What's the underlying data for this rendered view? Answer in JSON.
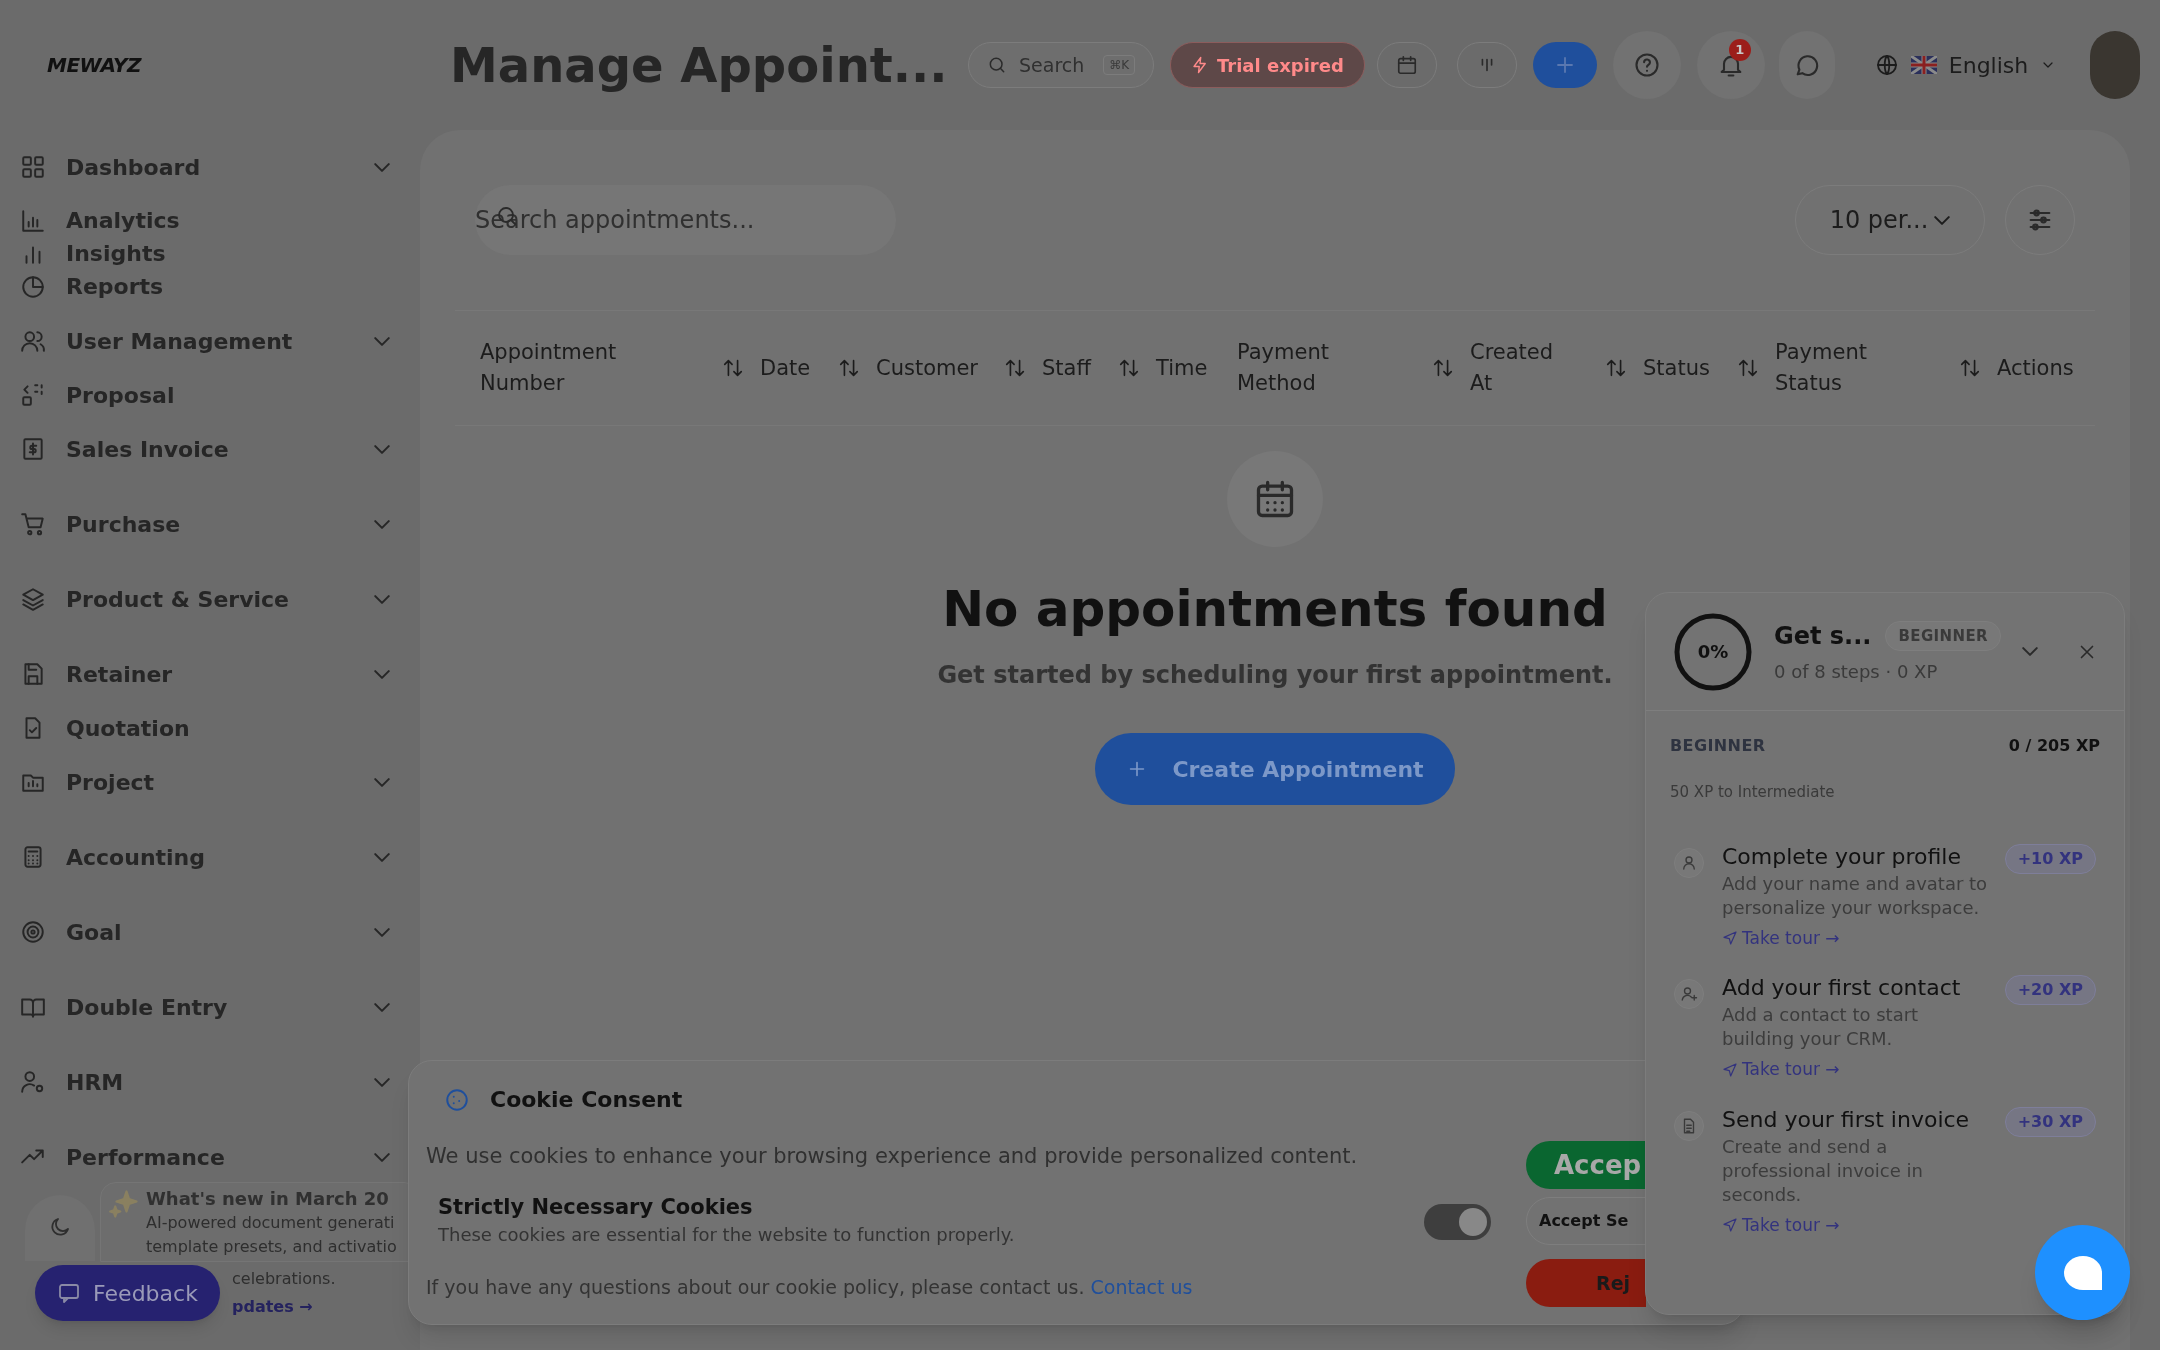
{
  "header": {
    "logo": "MEWAYZ",
    "title": "Manage Appoint...",
    "search": {
      "placeholder": "Search",
      "shortcut": "⌘K"
    },
    "trial_badge": "Trial expired",
    "notification_count": "1",
    "language": "English"
  },
  "sidebar": {
    "items": [
      {
        "kind": "group",
        "label": "Dashboard",
        "children": [
          {
            "label": "Analytics"
          },
          {
            "label": "Insights"
          },
          {
            "label": "Reports"
          }
        ]
      },
      {
        "kind": "group",
        "label": "User Management"
      },
      {
        "kind": "link",
        "label": "Proposal"
      },
      {
        "kind": "group",
        "label": "Sales Invoice"
      },
      {
        "kind": "group",
        "label": "Purchase"
      },
      {
        "kind": "group",
        "label": "Product & Service"
      },
      {
        "kind": "group",
        "label": "Retainer"
      },
      {
        "kind": "link",
        "label": "Quotation"
      },
      {
        "kind": "group",
        "label": "Project"
      },
      {
        "kind": "group",
        "label": "Accounting"
      },
      {
        "kind": "group",
        "label": "Goal"
      },
      {
        "kind": "group",
        "label": "Double Entry"
      },
      {
        "kind": "group",
        "label": "HRM"
      },
      {
        "kind": "group",
        "label": "Performance"
      }
    ],
    "whats_new": {
      "title": "What's new in March 20",
      "lines": [
        "AI-powered document generati",
        "template presets, and activatio"
      ],
      "tail": "celebrations.",
      "link": "pdates →"
    },
    "feedback": "Feedback"
  },
  "toolbar": {
    "search": {
      "placeholder": "Search appointments..."
    },
    "per_page": "10 per..."
  },
  "table": {
    "columns": [
      {
        "label": "Appointment Number",
        "sortable": true
      },
      {
        "label": "Date",
        "sortable": true
      },
      {
        "label": "Customer",
        "sortable": true
      },
      {
        "label": "Staff",
        "sortable": true
      },
      {
        "label": "Time",
        "sortable": false
      },
      {
        "label": "Payment Method",
        "sortable": true
      },
      {
        "label": "Created At",
        "sortable": true
      },
      {
        "label": "Status",
        "sortable": true
      },
      {
        "label": "Payment Status",
        "sortable": true
      },
      {
        "label": "Actions",
        "sortable": false
      }
    ]
  },
  "empty_state": {
    "title": "No appointments found",
    "subtitle": "Get started by scheduling your first appointment.",
    "button": "Create Appointment"
  },
  "cookie_consent": {
    "title": "Cookie Consent",
    "message": "We use cookies to enhance your browsing experience and provide personalized content.",
    "category": {
      "title": "Strictly Necessary Cookies",
      "description": "These cookies are essential for the website to function properly.",
      "on": true
    },
    "footer": "If you have any questions about our cookie policy, please contact us.",
    "link": "Contact us",
    "buttons": [
      {
        "kind": "accept",
        "label": "Accep"
      },
      {
        "kind": "settings",
        "label": "Accept Se"
      },
      {
        "kind": "reject",
        "label": "Rej"
      }
    ]
  },
  "onboarding": {
    "progress_label": "0%",
    "level": 0,
    "title": "Get s...",
    "badge": "BEGINNER",
    "steps": "0 of 8 steps · 0 XP",
    "tier": "BEGINNER",
    "xp": "0 / 205 XP",
    "next": "50 XP to Intermediate",
    "tasks": [
      {
        "kind": "profile",
        "title": "Complete your profile",
        "description": "Add your name and avatar to personalize your workspace.",
        "xp": "+10 XP",
        "link": "Take tour →"
      },
      {
        "kind": "contact",
        "title": "Add your first contact",
        "description": "Add a contact to start building your CRM.",
        "xp": "+20 XP",
        "link": "Take tour →"
      },
      {
        "kind": "invoice",
        "title": "Send your first invoice",
        "description": "Create and send a professional invoice in seconds.",
        "xp": "+30 XP",
        "link": "Take tour →"
      }
    ]
  }
}
